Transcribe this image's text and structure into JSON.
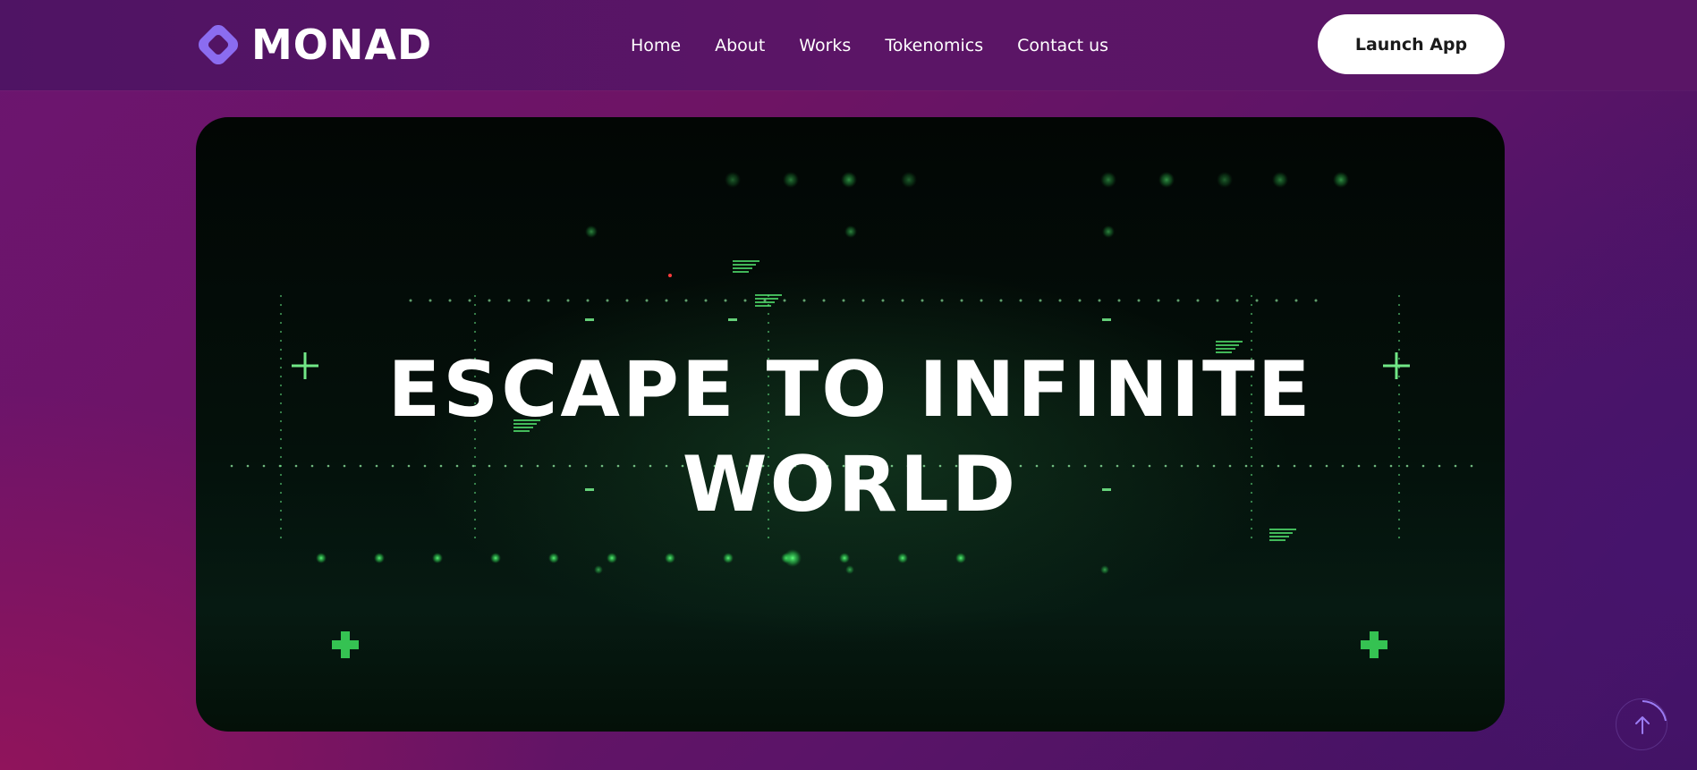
{
  "brand": {
    "name": "MONAD",
    "icon": "monad-diamond-icon",
    "accent_color": "#8b6cf0"
  },
  "nav": {
    "links": [
      {
        "label": "Home"
      },
      {
        "label": "About"
      },
      {
        "label": "Works"
      },
      {
        "label": "Tokenomics"
      },
      {
        "label": "Contact us"
      }
    ],
    "cta_label": "Launch App"
  },
  "hero": {
    "title_line1": "ESCAPE TO INFINITE",
    "title_line2": "WORLD",
    "background": "green digital grid"
  },
  "scroll_top": {
    "icon": "arrow-up-icon"
  }
}
